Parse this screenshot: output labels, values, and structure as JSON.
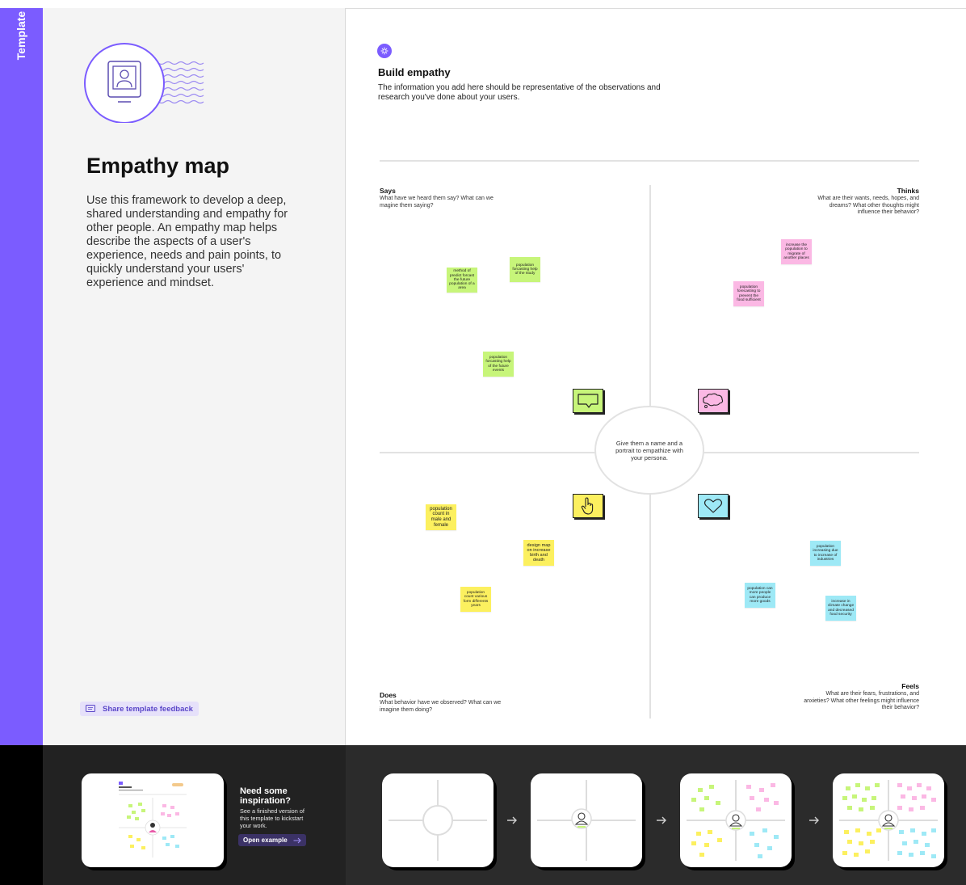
{
  "template_tab": {
    "label": "Template"
  },
  "left": {
    "title": "Empathy map",
    "description": "Use this framework to develop a deep, shared understanding and empathy for other people. An empathy map helps describe the aspects of a user's experience, needs and pain points, to quickly understand your users' experience and mindset.",
    "feedback_label": "Share template feedback"
  },
  "header": {
    "title": "Build empathy",
    "description": "The information you add here should be representative of the observations and research you've done about your users."
  },
  "quadrants": {
    "says": {
      "title": "Says",
      "subtitle": "What have we heard them say? What can we magine them saying?"
    },
    "thinks": {
      "title": "Thinks",
      "subtitle": "What are their wants, needs, hopes, and dreams? What other thoughts might influence their behavior?"
    },
    "does": {
      "title": "Does",
      "subtitle": "What behavior have we observed? What can we imagine them doing?"
    },
    "feels": {
      "title": "Feels",
      "subtitle": "What are their fears, frustrations, and anxieties? What other feelings might influence their behavior?"
    }
  },
  "persona": {
    "text": "Give them a name and a portrait to empathize with your persona."
  },
  "icons": {
    "says": "speech-bubble-icon",
    "thinks": "thought-bubble-icon",
    "does": "pointing-hand-icon",
    "feels": "heart-icon"
  },
  "colors": {
    "accent": "#7b5cff",
    "says": "#c7f57a",
    "thinks": "#fbb8e4",
    "does": "#fcf05f",
    "feels": "#9ee9f6"
  },
  "stickies": {
    "says": [
      "method of predict forcast the future population of a area",
      "population forcasting help of the study",
      "population forcasting help of the future events"
    ],
    "thinks": [
      "increase the population to migrate of another places",
      "population forecasting to prevent the food sufficient"
    ],
    "does": [
      "population count in male and female",
      "design map on increase birth and death",
      "population count various form differents years"
    ],
    "feels": [
      "population increasing due to increase of industries",
      "population can more people can produce more goods",
      "increase in climate change and decreased food security"
    ]
  },
  "inspiration": {
    "title": "Need some inspiration?",
    "description": "See a finished version of this template to kickstart your work.",
    "button_label": "Open example"
  }
}
